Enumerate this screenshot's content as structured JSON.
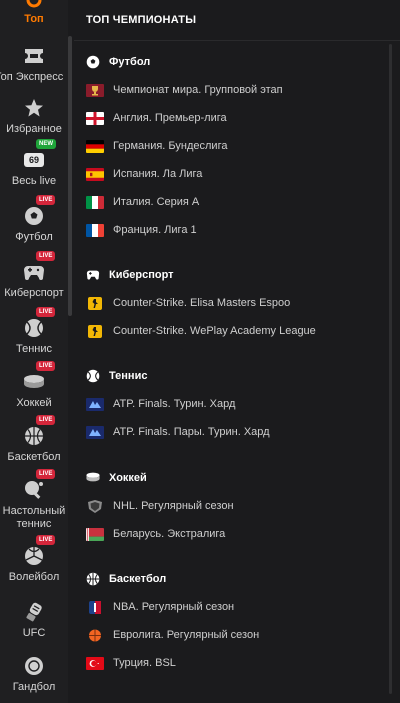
{
  "sidebar": {
    "items": [
      {
        "label": "Топ",
        "active": true
      },
      {
        "label": "Топ Экспресс"
      },
      {
        "label": "Избранное"
      },
      {
        "label": "Весь live",
        "counter": "69",
        "badge": "NEW"
      },
      {
        "label": "Футбол",
        "badge": "LIVE"
      },
      {
        "label": "Киберспорт",
        "badge": "LIVE"
      },
      {
        "label": "Теннис",
        "badge": "LIVE"
      },
      {
        "label": "Хоккей",
        "badge": "LIVE"
      },
      {
        "label": "Баскетбол",
        "badge": "LIVE"
      },
      {
        "label": "Настольный теннис",
        "badge": "LIVE"
      },
      {
        "label": "Волейбол",
        "badge": "LIVE"
      },
      {
        "label": "UFC"
      },
      {
        "label": "Гандбол"
      }
    ]
  },
  "main": {
    "title": "ТОП ЧЕМПИОНАТЫ",
    "sections": [
      {
        "title": "Футбол",
        "rows": [
          "Чемпионат мира. Групповой этап",
          "Англия. Премьер-лига",
          "Германия. Бундеслига",
          "Испания. Ла Лига",
          "Италия. Серия А",
          "Франция. Лига 1"
        ]
      },
      {
        "title": "Киберспорт",
        "rows": [
          "Counter-Strike. Elisa Masters Espoo",
          "Counter-Strike. WePlay Academy League"
        ]
      },
      {
        "title": "Теннис",
        "rows": [
          "ATP. Finals. Турин. Хард",
          "ATP. Finals. Пары. Турин. Хард"
        ]
      },
      {
        "title": "Хоккей",
        "rows": [
          "NHL. Регулярный сезон",
          "Беларусь. Экстралига"
        ]
      },
      {
        "title": "Баскетбол",
        "rows": [
          "NBA. Регулярный сезон",
          "Евролига. Регулярный сезон",
          "Турция. BSL"
        ]
      }
    ]
  },
  "colors": {
    "accent": "#ff7a00",
    "live_badge": "#d4263b",
    "new_badge": "#1fa53a",
    "background": "#1b1b1d"
  }
}
